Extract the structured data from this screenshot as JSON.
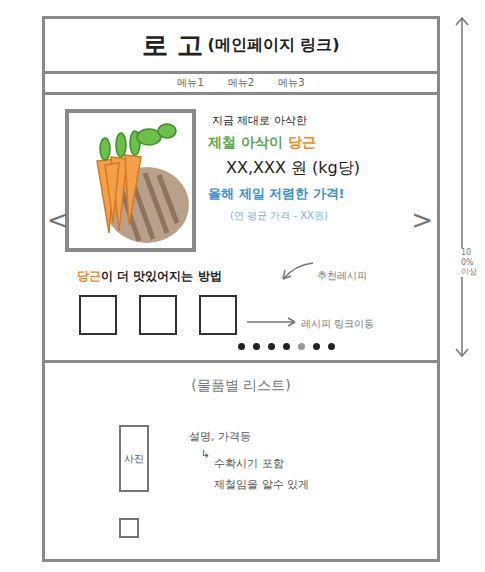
{
  "header": {
    "logo": "로 고",
    "logo_note": "(메인페이지 링크)"
  },
  "menu": [
    {
      "label": "메뉴1"
    },
    {
      "label": "메뉴2"
    },
    {
      "label": "메뉴3"
    }
  ],
  "hero": {
    "prev": "<",
    "next": ">",
    "tagline": "지금 제대로 아삭한",
    "title": [
      {
        "text": "제철 아삭이 ",
        "color": "#5aa84a"
      },
      {
        "text": "당근",
        "color": "#f0892a"
      }
    ],
    "price": "XX,XXX 원 (kg당)",
    "deal": "올해 제일 저렴한 가격!",
    "avg": "(연 평균 가격 - XX원)",
    "recipe_title": [
      {
        "text": "당근",
        "color": "#f0892a"
      },
      {
        "text": "이 더 맛있어지는 방법",
        "color": "#222222"
      }
    ],
    "recipe_note": "추천레시피",
    "link_note": "레시피 링크이동",
    "dots": [
      {
        "selected": false
      },
      {
        "selected": false
      },
      {
        "selected": false
      },
      {
        "selected": false
      },
      {
        "selected": true
      },
      {
        "selected": false
      },
      {
        "selected": false
      }
    ]
  },
  "height_note": "100% 이상",
  "list": {
    "title": "(물품별 리스트)",
    "items": [
      {
        "kind": "detail",
        "photo": "사진",
        "desc": "설명, 가격등",
        "arrow": "↳",
        "notes": [
          "수확시기 포함",
          "제철임을 알수 있게"
        ]
      },
      {
        "kind": "blank"
      }
    ]
  }
}
